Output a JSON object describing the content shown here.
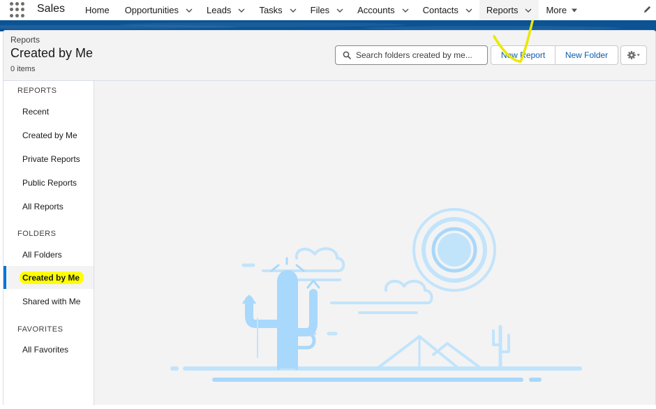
{
  "app": {
    "name": "Sales"
  },
  "nav": {
    "items": [
      {
        "label": "Home",
        "dropdown": false
      },
      {
        "label": "Opportunities",
        "dropdown": true
      },
      {
        "label": "Leads",
        "dropdown": true
      },
      {
        "label": "Tasks",
        "dropdown": true
      },
      {
        "label": "Files",
        "dropdown": true
      },
      {
        "label": "Accounts",
        "dropdown": true
      },
      {
        "label": "Contacts",
        "dropdown": true
      },
      {
        "label": "Reports",
        "dropdown": true,
        "active": true
      },
      {
        "label": "More",
        "dropdown": true
      }
    ]
  },
  "header": {
    "breadcrumb": "Reports",
    "title": "Created by Me",
    "count": "0 items"
  },
  "search": {
    "placeholder": "Search folders created by me..."
  },
  "buttons": {
    "new_report": "New Report",
    "new_folder": "New Folder"
  },
  "sidebar": {
    "sections": [
      {
        "title": "REPORTS",
        "items": [
          "Recent",
          "Created by Me",
          "Private Reports",
          "Public Reports",
          "All Reports"
        ]
      },
      {
        "title": "FOLDERS",
        "items": [
          "All Folders",
          "Created by Me",
          "Shared with Me"
        ]
      },
      {
        "title": "FAVORITES",
        "items": [
          "All Favorites"
        ]
      }
    ],
    "selected": "Created by Me"
  },
  "icons": {
    "app_launcher": "waffle-icon",
    "chevron": "chevron-down-icon",
    "edit": "pencil-icon",
    "search": "search-icon",
    "settings": "gear-icon"
  },
  "colors": {
    "brand_band": "#0b5394",
    "link": "#0b5cab",
    "selected_border": "#0176d3",
    "highlight": "#ffff00",
    "illustration": "#a8d8fb"
  }
}
